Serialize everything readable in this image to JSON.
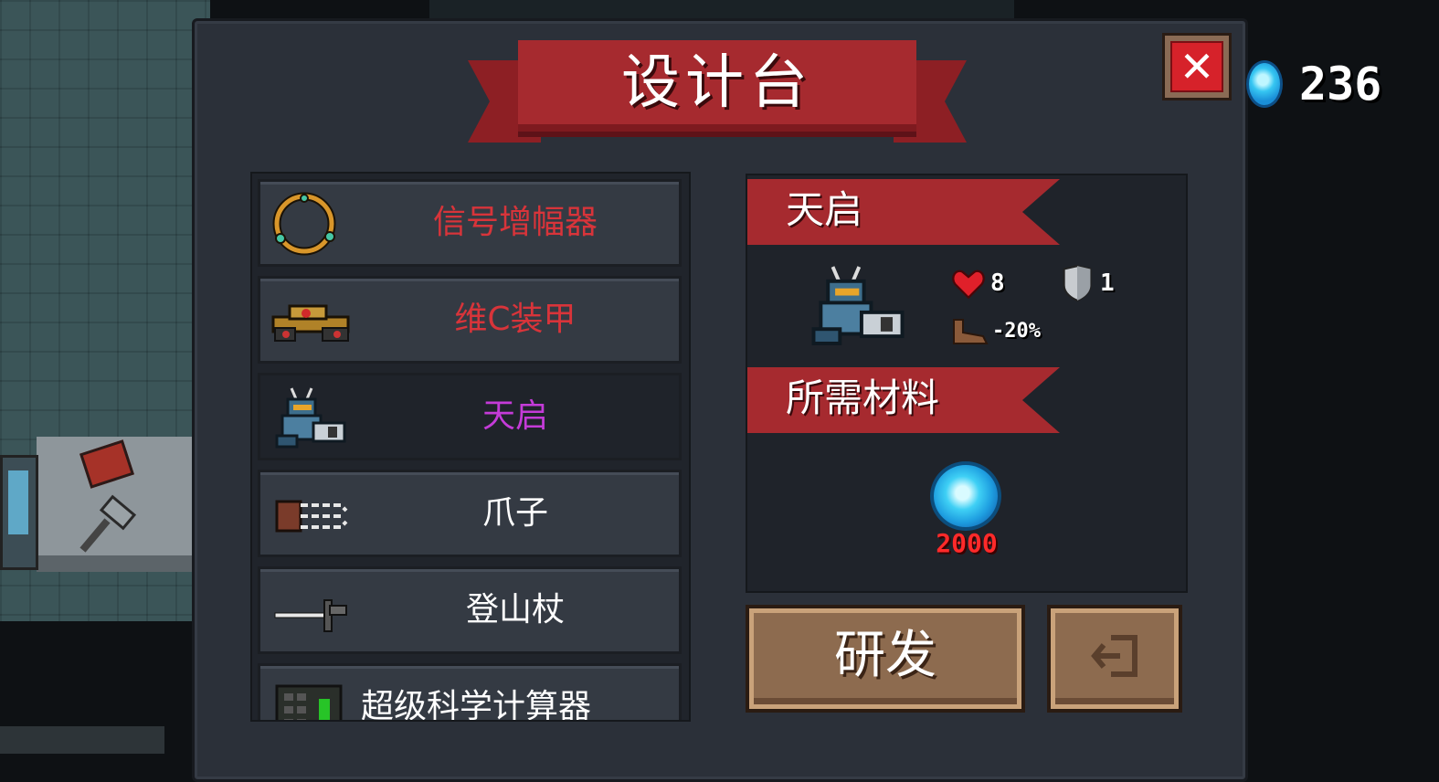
{
  "title": "设计台",
  "currency": {
    "gem_count": "236",
    "icon": "gem-icon"
  },
  "close_button": {
    "label": "✕",
    "icon": "close-icon"
  },
  "blueprints": [
    {
      "name": "信号增幅器",
      "color": "#d8343a",
      "icon": "ring-icon"
    },
    {
      "name": "维C装甲",
      "color": "#d8343a",
      "icon": "armored-vehicle-icon"
    },
    {
      "name": "天启",
      "color": "#c43bd8",
      "icon": "mech-icon",
      "selected": true
    },
    {
      "name": "爪子",
      "color": "#ffffff",
      "icon": "claw-icon"
    },
    {
      "name": "登山杖",
      "color": "#ffffff",
      "icon": "trekking-pole-icon"
    },
    {
      "name": "超级科学计算器",
      "color": "#ffffff",
      "icon": "calculator-icon"
    }
  ],
  "detail": {
    "name": "天启",
    "stats": {
      "health": "8",
      "armor": "1",
      "speed": "-20%"
    },
    "materials_header": "所需材料",
    "material": {
      "icon": "gem-icon",
      "count": "2000",
      "count_color": "#ff2a2a"
    }
  },
  "research_button": {
    "label": "研发"
  },
  "exit_button": {
    "icon": "exit-icon"
  }
}
